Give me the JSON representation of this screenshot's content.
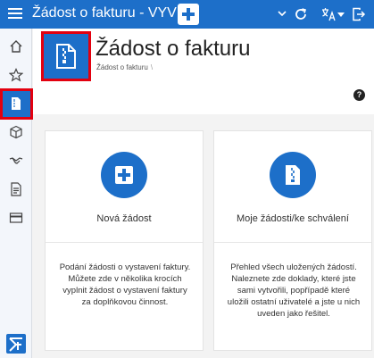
{
  "topbar": {
    "app_title": "Žádost o fakturu - VYV",
    "new_button_icon": "plus-icon",
    "icons": [
      "hamburger-menu-icon",
      "chevron-down-icon",
      "refresh-icon",
      "translate-icon",
      "logout-icon"
    ]
  },
  "sidebar": {
    "items": [
      {
        "icon": "home-icon"
      },
      {
        "icon": "star-icon"
      },
      {
        "icon": "invoice-file-icon",
        "active": true
      },
      {
        "icon": "box-icon"
      },
      {
        "icon": "handshake-icon"
      },
      {
        "icon": "document-icon"
      },
      {
        "icon": "card-icon"
      }
    ],
    "logo_icon": "app-logo-icon"
  },
  "page": {
    "title": "Žádost o fakturu",
    "breadcrumb": "Žádost o fakturu",
    "breadcrumb_sep": "\\",
    "help_label": "?"
  },
  "tiles": [
    {
      "label": "Nová žádost",
      "icon": "plus-icon",
      "description": "Podání žádosti o vystavení faktury. Můžete zde v několika krocích vyplnit žádost o vystavení faktury za doplňkovou činnost."
    },
    {
      "label": "Moje žádosti/ke schválení",
      "icon": "invoice-file-icon",
      "description": "Přehled všech uložených žádostí. Naleznete zde doklady, které jste sami vytvořili, popřípadě které uložili ostatní uživatelé a jste u nich uveden jako řešitel."
    }
  ],
  "colors": {
    "brand": "#1d6fc9",
    "highlight": "#e3000f",
    "background": "#f3f3f3"
  }
}
